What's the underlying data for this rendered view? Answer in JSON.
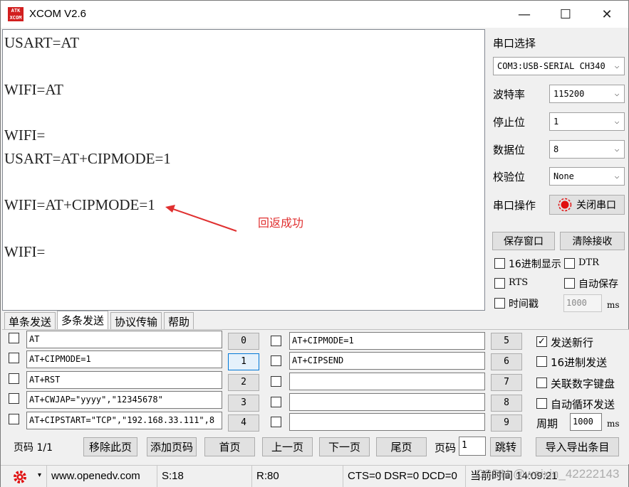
{
  "window": {
    "title": "XCOM V2.6",
    "logo_text": "ATK XCOM",
    "minimize": "—",
    "maximize": "☐",
    "close": "✕"
  },
  "receive": {
    "lines": [
      "USART=AT",
      "WIFI=AT",
      "WIFI=",
      "USART=AT+CIPMODE=1",
      "WIFI=AT+CIPMODE=1",
      "WIFI="
    ],
    "annotation": "回返成功"
  },
  "serial": {
    "select_label": "串口选择",
    "port_value": "COM3:USB-SERIAL CH340",
    "baud_label": "波特率",
    "baud_value": "115200",
    "stop_label": "停止位",
    "stop_value": "1",
    "data_label": "数据位",
    "data_value": "8",
    "parity_label": "校验位",
    "parity_value": "None",
    "op_label": "串口操作",
    "close_port_label": "关闭串口"
  },
  "rx_controls": {
    "save_window": "保存窗口",
    "clear_receive": "清除接收",
    "hex_display": "16进制显示",
    "dtr": "DTR",
    "rts": "RTS",
    "auto_save": "自动保存",
    "timestamp": "时间戳",
    "timestamp_value": "1000",
    "timestamp_unit": "ms"
  },
  "tabs": [
    "单条发送",
    "多条发送",
    "协议传输",
    "帮助"
  ],
  "multi_send": {
    "left": [
      {
        "text": "AT",
        "num": "0"
      },
      {
        "text": "AT+CIPMODE=1",
        "num": "1"
      },
      {
        "text": "AT+RST",
        "num": "2"
      },
      {
        "text": "AT+CWJAP=\"yyyy\",\"12345678\"",
        "num": "3"
      },
      {
        "text": "AT+CIPSTART=\"TCP\",\"192.168.33.111\",8",
        "num": "4"
      }
    ],
    "right": [
      {
        "text": "AT+CIPMODE=1",
        "num": "5"
      },
      {
        "text": "AT+CIPSEND",
        "num": "6"
      },
      {
        "text": "",
        "num": "7"
      },
      {
        "text": "",
        "num": "8"
      },
      {
        "text": "",
        "num": "9"
      }
    ],
    "send_newline": "发送新行",
    "hex_send": "16进制发送",
    "link_keypad": "关联数字键盘",
    "auto_loop": "自动循环发送",
    "period_label": "周期",
    "period_value": "1000",
    "period_unit": "ms"
  },
  "pager": {
    "page_label": "页码 1/1",
    "remove_page": "移除此页",
    "add_page": "添加页码",
    "first": "首页",
    "prev": "上一页",
    "next": "下一页",
    "last": "尾页",
    "page_field_label": "页码",
    "page_field_value": "1",
    "jump": "跳转",
    "import_export": "导入导出条目"
  },
  "status": {
    "url": "www.openedv.com",
    "sent": "S:18",
    "received": "R:80",
    "lines": "CTS=0 DSR=0 DCD=0",
    "time": "当前时间 14:09:21",
    "watermark": "CSDN @weixin_42222143"
  },
  "colors": {
    "annotation": "#e03030",
    "led": "#e01010"
  }
}
